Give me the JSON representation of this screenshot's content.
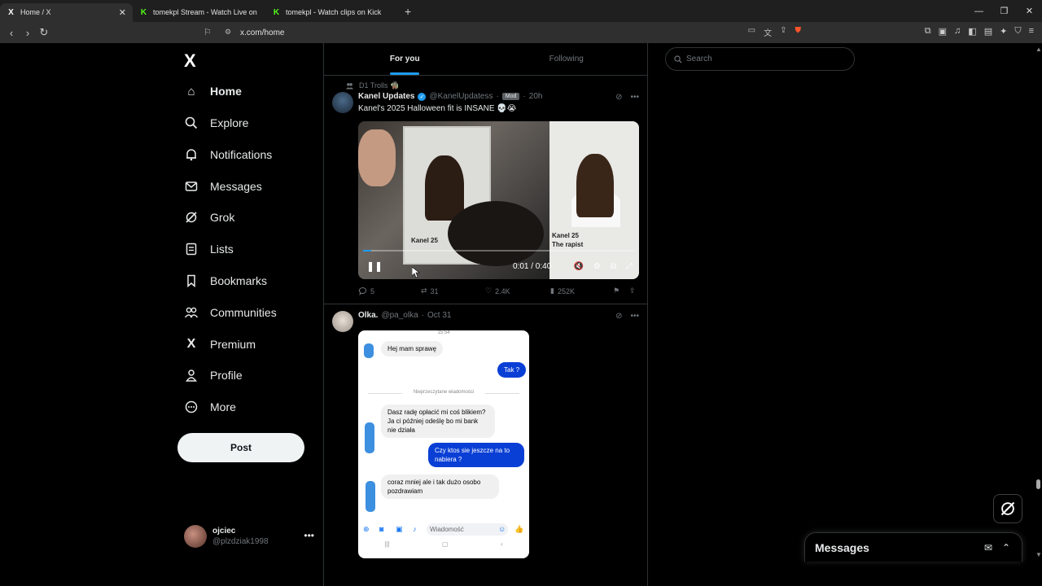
{
  "browser": {
    "tabs": [
      {
        "title": "Home / X",
        "icon": "x-logo-icon"
      },
      {
        "title": "tomekpl Stream - Watch Live on Kick",
        "icon": "kick-icon"
      },
      {
        "title": "tomekpl - Watch clips on Kick",
        "icon": "kick-icon"
      }
    ],
    "new_tab_glyph": "+",
    "url": "x.com/home"
  },
  "sidebar": {
    "items": [
      {
        "label": "Home",
        "icon": "home-icon",
        "glyph": "⌂"
      },
      {
        "label": "Explore",
        "icon": "search-icon",
        "glyph": "⚲"
      },
      {
        "label": "Notifications",
        "icon": "bell-icon",
        "glyph": "🔔"
      },
      {
        "label": "Messages",
        "icon": "envelope-icon",
        "glyph": "✉"
      },
      {
        "label": "Grok",
        "icon": "grok-icon",
        "glyph": "⊘"
      },
      {
        "label": "Lists",
        "icon": "list-icon",
        "glyph": "☰"
      },
      {
        "label": "Bookmarks",
        "icon": "bookmark-icon",
        "glyph": "⚑"
      },
      {
        "label": "Communities",
        "icon": "communities-icon",
        "glyph": "👥"
      },
      {
        "label": "Premium",
        "icon": "x-logo-icon",
        "glyph": "X"
      },
      {
        "label": "Profile",
        "icon": "person-icon",
        "glyph": "👤"
      },
      {
        "label": "More",
        "icon": "more-circle-icon",
        "glyph": "⋯"
      }
    ],
    "post_label": "Post",
    "account": {
      "name": "ojciec",
      "handle": "@plzdziak1998"
    }
  },
  "feed": {
    "tabs": [
      {
        "label": "For you"
      },
      {
        "label": "Following"
      }
    ],
    "tweets": [
      {
        "context": "D1 Trolls 🧌",
        "name": "Kanel Updates",
        "handle": "@KanelUpdatess",
        "badge": "Mod",
        "time": "20h",
        "text": "Kanel's 2025 Halloween fit is INSANE 💀😭",
        "video": {
          "time": "0:01 / 0:40",
          "progress": 0.03,
          "label_left": "Kanel 25",
          "label_right_1": "Kanel 25",
          "label_right_2": "The rapist"
        },
        "metrics": {
          "replies": "5",
          "reposts": "31",
          "likes": "2.4K",
          "views": "252K"
        }
      },
      {
        "name": "Olka.",
        "handle": "@pa_olka",
        "time": "Oct 31",
        "screenshot": {
          "time": "15:54",
          "msg1": "Hej mam sprawę",
          "msg2": "Tak ?",
          "divider": "Nieprzeczytane wiadomości",
          "msg3": "Dasz radę opłacić mi coś blikiem? Ja ci później odeślę bo mi bank nie działa",
          "msg4": "Czy ktos sie jeszcze na to nabiera ?",
          "msg5": "coraz mniej ale i tak dużo osobo pozdrawiam",
          "input_placeholder": "Wiadomość"
        }
      }
    ]
  },
  "right": {
    "search_placeholder": "Search"
  },
  "messages_drawer": {
    "title": "Messages"
  },
  "colors": {
    "accent": "#1d9bf0",
    "border": "#2f3336",
    "muted": "#71767b",
    "messenger_blue": "#0a3fd6"
  }
}
